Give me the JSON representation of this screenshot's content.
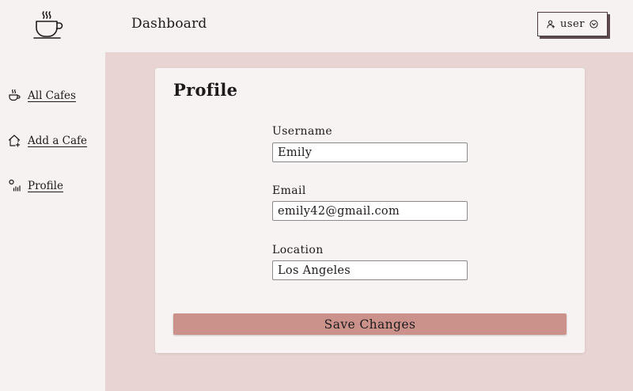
{
  "header": {
    "logo_icon": "coffee-cup-icon",
    "title": "Dashboard",
    "user_menu": {
      "label": "user",
      "icon": "user-icon",
      "chevron_icon": "chevron-down-circle-icon"
    }
  },
  "sidebar": {
    "items": [
      {
        "label": "All Cafes",
        "icon": "coffee-cup-icon"
      },
      {
        "label": "Add a Cafe",
        "icon": "house-plus-icon"
      },
      {
        "label": "Profile",
        "icon": "profile-stats-icon"
      }
    ]
  },
  "profile": {
    "title": "Profile",
    "fields": {
      "username": {
        "label": "Username",
        "value": "Emily"
      },
      "email": {
        "label": "Email",
        "value": "emily42@gmail.com"
      },
      "location": {
        "label": "Location",
        "value": "Los Angeles"
      }
    },
    "save_label": "Save Changes"
  },
  "colors": {
    "background": "#f6f2f1",
    "main_background": "#e7d4d3",
    "card_background": "#f7f3f2",
    "accent": "#cb928c",
    "text": "#1e1a1b"
  }
}
